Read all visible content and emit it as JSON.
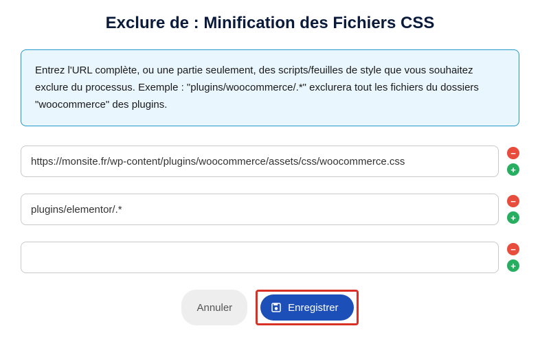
{
  "title": "Exclure de : Minification des Fichiers CSS",
  "info_text": "Entrez l'URL complète, ou une partie seulement, des scripts/feuilles de style que vous souhaitez exclure du processus. Exemple : \"plugins/woocommerce/.*\" exclurera tout les fichiers du dossiers \"woocommerce\" des plugins.",
  "rows": [
    {
      "value": "https://monsite.fr/wp-content/plugins/woocommerce/assets/css/woocommerce.css"
    },
    {
      "value": "plugins/elementor/.*"
    },
    {
      "value": ""
    }
  ],
  "buttons": {
    "cancel": "Annuler",
    "save": "Enregistrer"
  },
  "icons": {
    "remove": "−",
    "add": "+"
  }
}
